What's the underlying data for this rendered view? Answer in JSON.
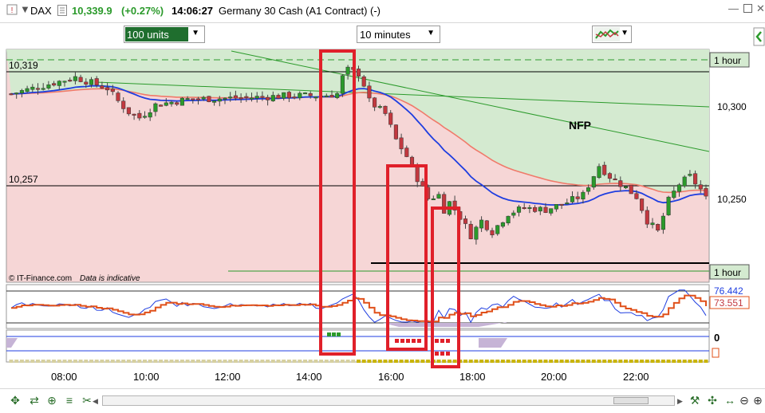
{
  "header": {
    "symbol": "DAX",
    "price": "10,339.9",
    "change": "(+0.27%)",
    "time": "14:06:27",
    "instrument": "Germany 30 Cash (A1 Contract) (-)"
  },
  "toolbar": {
    "units_value": "100 units",
    "interval_value": "10 minutes"
  },
  "chart_data": {
    "type": "candlestick",
    "price_axis": {
      "labels": [
        "10,300",
        "10,250"
      ],
      "ylim": [
        10210,
        10325
      ]
    },
    "time_axis": {
      "labels": [
        "08:00",
        "10:00",
        "12:00",
        "14:00",
        "16:00",
        "18:00",
        "20:00",
        "22:00"
      ]
    },
    "horizontal_lines": [
      {
        "label": "10,319",
        "value": 10319
      },
      {
        "label": "10,257",
        "value": 10257
      }
    ],
    "timeframe_tags": [
      "1 hour",
      "1 hour"
    ],
    "annotations": [
      "NFP"
    ],
    "credit": "© IT-Finance.com",
    "disclaimer": "Data is indicative",
    "indicator_values": [
      "76.442",
      "73.551"
    ],
    "bottom_panel_value": "0",
    "colors": {
      "bull": "#2b9a2b",
      "bear": "#c2383f",
      "fast_ma": "#1f3ee0",
      "slow_ma": "#f07a6a",
      "highlight": "#e0202a",
      "bg_up": "#d4ead0",
      "bg_down": "#f6d6d6"
    }
  }
}
